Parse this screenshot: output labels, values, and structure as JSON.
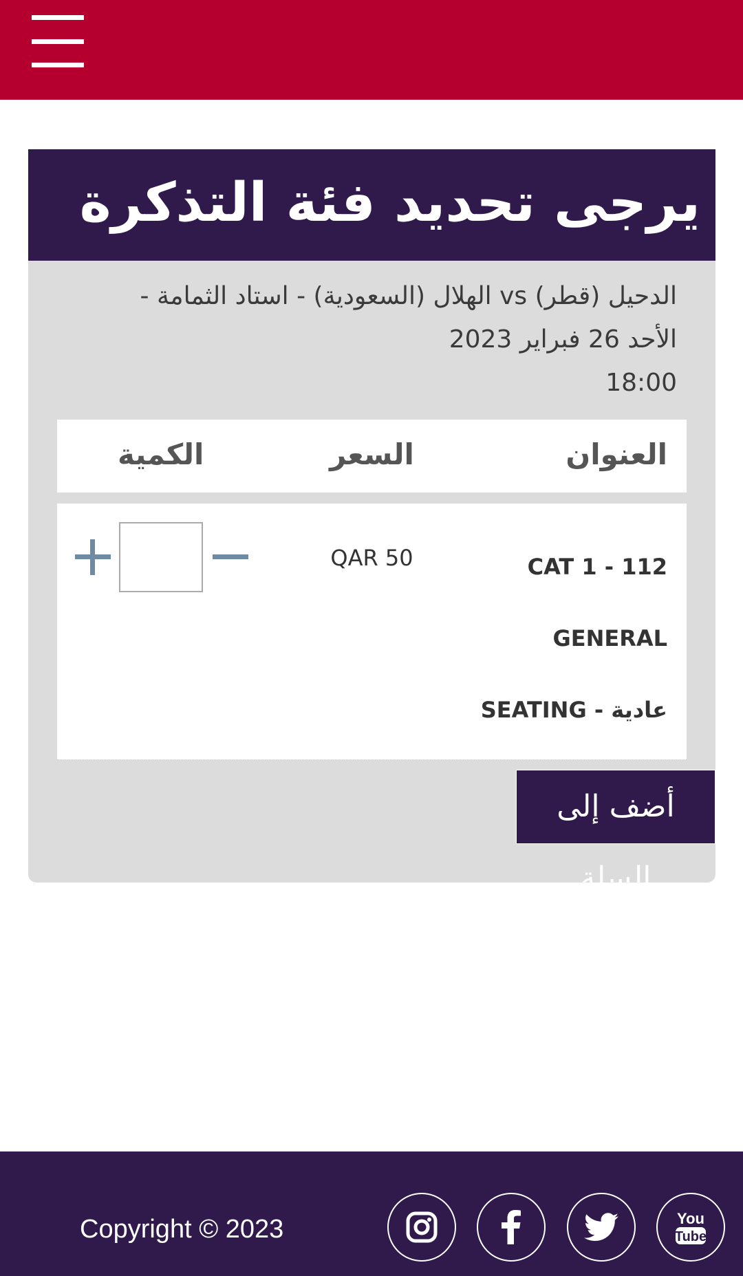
{
  "header": {
    "menu_icon": "hamburger-menu-icon"
  },
  "card": {
    "title": "يرجى تحديد فئة التذكرة",
    "event": {
      "line1": "الدحيل (قطر) vs الهلال (السعودية)  -  استاد الثمامة   -",
      "line2": "الأحد 26   فبراير 2023",
      "line3": "18:00"
    },
    "table": {
      "headers": {
        "title": "العنوان",
        "price": "السعر",
        "quantity": "الكمية"
      },
      "rows": [
        {
          "name_lines": [
            "CAT 1 - 112",
            "GENERAL",
            "SEATING - عادية"
          ],
          "price": "QAR 50",
          "quantity": ""
        }
      ]
    },
    "add_to_cart": "أضف إلى السلة"
  },
  "footer": {
    "copyright": "Copyright © 2023",
    "social": [
      "instagram-icon",
      "facebook-icon",
      "twitter-icon",
      "youtube-icon"
    ],
    "youtube_text": {
      "line1": "You",
      "line2": "Tube"
    }
  },
  "colors": {
    "header_bg": "#b5002f",
    "primary_dark": "#2f1a4b",
    "card_bg": "#dcdcdc",
    "stepper": "#6f8aa3"
  }
}
